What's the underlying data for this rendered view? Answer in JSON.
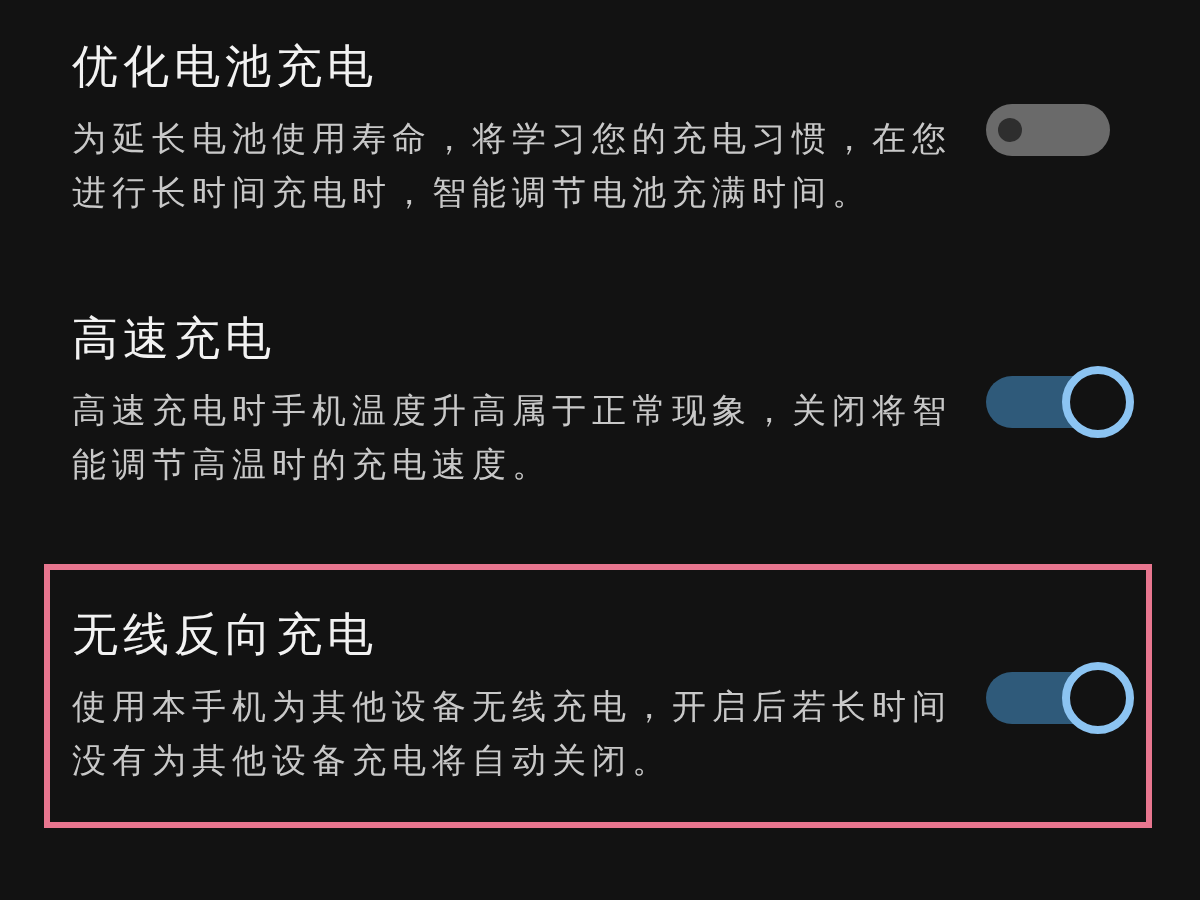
{
  "settings": [
    {
      "title": "优化电池充电",
      "description": "为延长电池使用寿命，将学习您的充电习惯，在您进行长时间充电时，智能调节电池充满时间。",
      "on": false,
      "highlighted": false
    },
    {
      "title": "高速充电",
      "description": "高速充电时手机温度升高属于正常现象，关闭将智能调节高温时的充电速度。",
      "on": true,
      "highlighted": false
    },
    {
      "title": "无线反向充电",
      "description": "使用本手机为其他设备无线充电，开启后若长时间没有为其他设备充电将自动关闭。",
      "on": true,
      "highlighted": true
    }
  ]
}
